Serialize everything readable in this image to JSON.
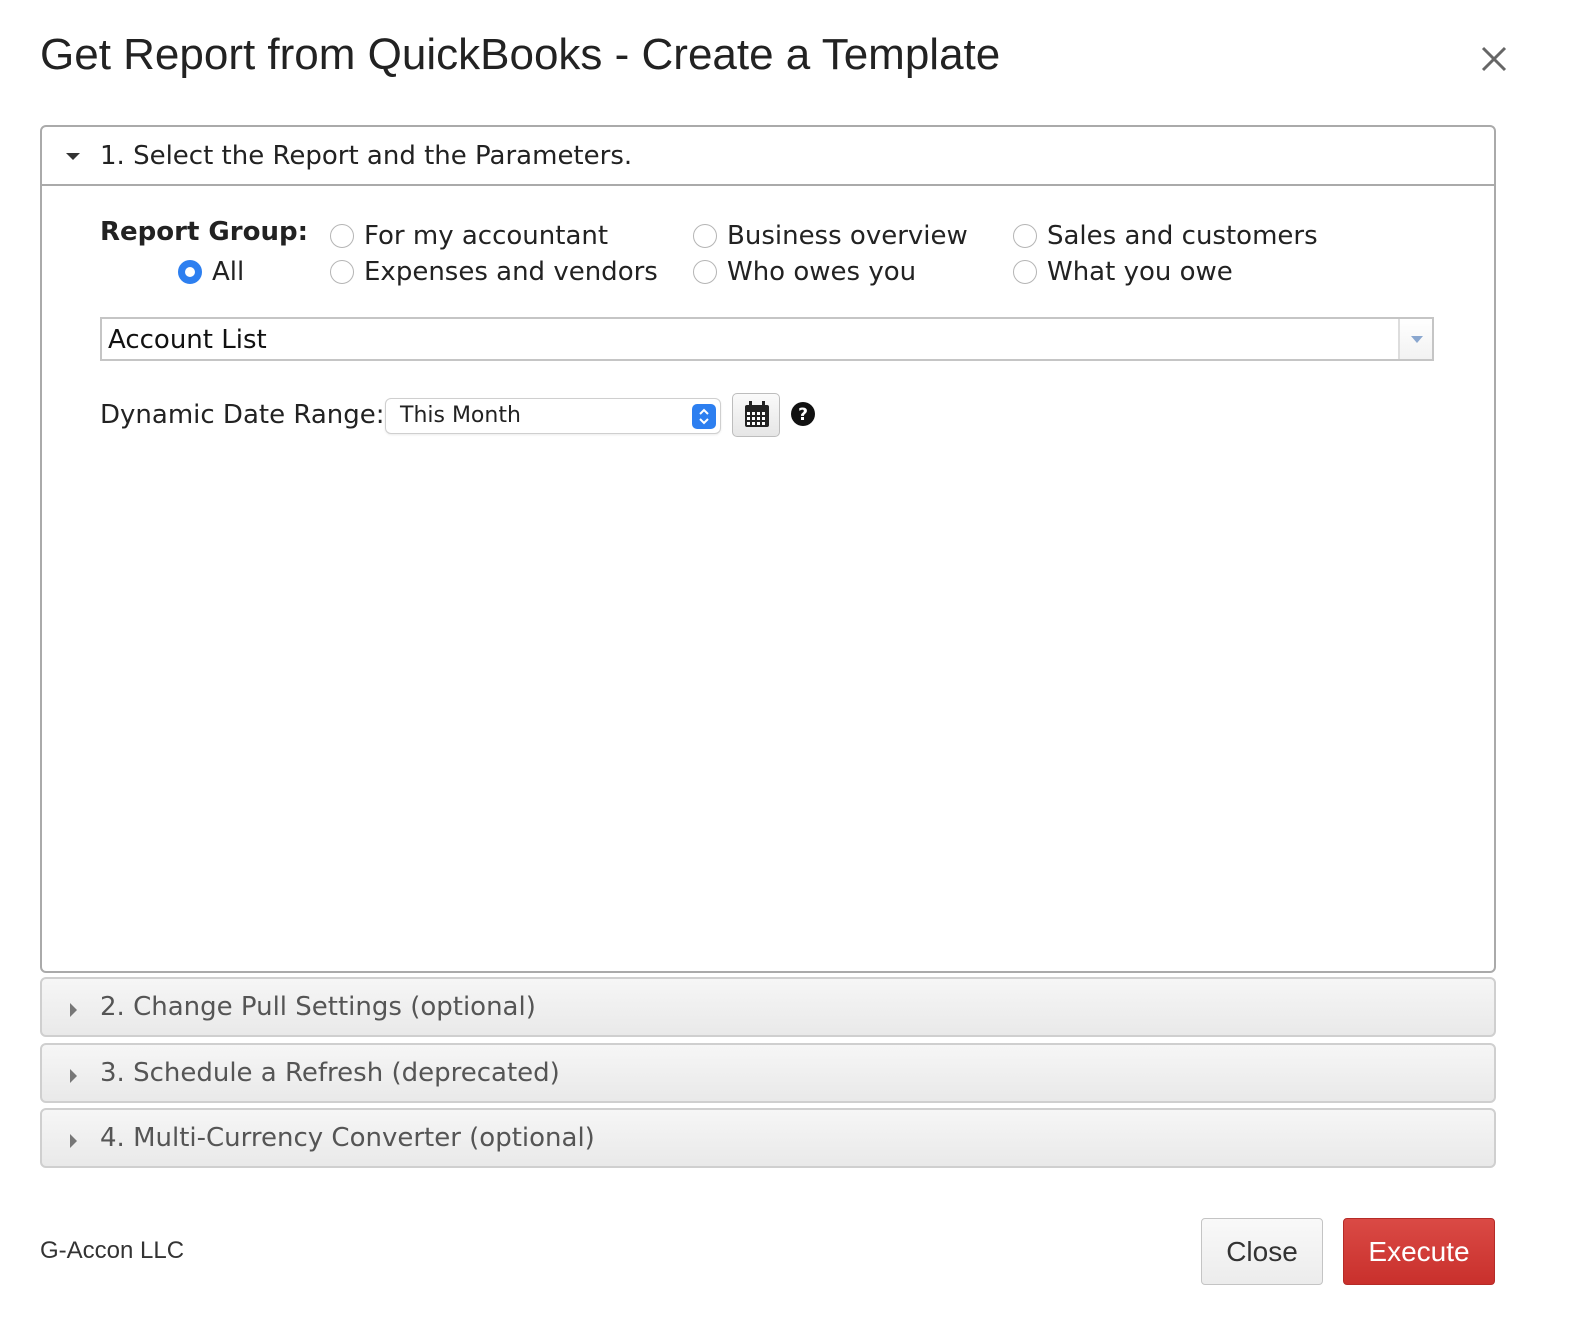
{
  "dialog": {
    "title": "Get Report from QuickBooks - Create a Template"
  },
  "sections": [
    {
      "label": "1. Select the Report and the Parameters.",
      "expanded": true
    },
    {
      "label": "2. Change Pull Settings (optional)",
      "expanded": false
    },
    {
      "label": "3. Schedule a Refresh (deprecated)",
      "expanded": false
    },
    {
      "label": "4. Multi-Currency Converter (optional)",
      "expanded": false
    }
  ],
  "report_group": {
    "label": "Report Group:",
    "options": [
      {
        "label": "For my accountant",
        "checked": false
      },
      {
        "label": "Business overview",
        "checked": false
      },
      {
        "label": "Sales and customers",
        "checked": false
      },
      {
        "label": "All",
        "checked": true
      },
      {
        "label": "Expenses and vendors",
        "checked": false
      },
      {
        "label": "Who owes you",
        "checked": false
      },
      {
        "label": "What you owe",
        "checked": false
      }
    ]
  },
  "report_select": {
    "value": "Account List"
  },
  "date_range": {
    "label": "Dynamic Date Range:",
    "value": "This Month"
  },
  "footer": {
    "brand": "G-Accon LLC",
    "close_label": "Close",
    "execute_label": "Execute"
  },
  "colors": {
    "accent": "#2d7ff0",
    "execute": "#c9302c"
  }
}
